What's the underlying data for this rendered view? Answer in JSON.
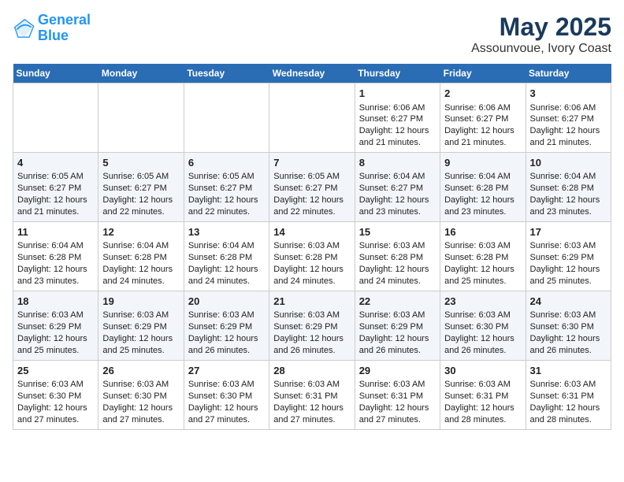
{
  "header": {
    "logo_general": "General",
    "logo_blue": "Blue",
    "month": "May 2025",
    "location": "Assounvoue, Ivory Coast"
  },
  "days_of_week": [
    "Sunday",
    "Monday",
    "Tuesday",
    "Wednesday",
    "Thursday",
    "Friday",
    "Saturday"
  ],
  "weeks": [
    [
      {
        "day": "",
        "info": ""
      },
      {
        "day": "",
        "info": ""
      },
      {
        "day": "",
        "info": ""
      },
      {
        "day": "",
        "info": ""
      },
      {
        "day": "1",
        "info": "Sunrise: 6:06 AM\nSunset: 6:27 PM\nDaylight: 12 hours\nand 21 minutes."
      },
      {
        "day": "2",
        "info": "Sunrise: 6:06 AM\nSunset: 6:27 PM\nDaylight: 12 hours\nand 21 minutes."
      },
      {
        "day": "3",
        "info": "Sunrise: 6:06 AM\nSunset: 6:27 PM\nDaylight: 12 hours\nand 21 minutes."
      }
    ],
    [
      {
        "day": "4",
        "info": "Sunrise: 6:05 AM\nSunset: 6:27 PM\nDaylight: 12 hours\nand 21 minutes."
      },
      {
        "day": "5",
        "info": "Sunrise: 6:05 AM\nSunset: 6:27 PM\nDaylight: 12 hours\nand 22 minutes."
      },
      {
        "day": "6",
        "info": "Sunrise: 6:05 AM\nSunset: 6:27 PM\nDaylight: 12 hours\nand 22 minutes."
      },
      {
        "day": "7",
        "info": "Sunrise: 6:05 AM\nSunset: 6:27 PM\nDaylight: 12 hours\nand 22 minutes."
      },
      {
        "day": "8",
        "info": "Sunrise: 6:04 AM\nSunset: 6:27 PM\nDaylight: 12 hours\nand 23 minutes."
      },
      {
        "day": "9",
        "info": "Sunrise: 6:04 AM\nSunset: 6:28 PM\nDaylight: 12 hours\nand 23 minutes."
      },
      {
        "day": "10",
        "info": "Sunrise: 6:04 AM\nSunset: 6:28 PM\nDaylight: 12 hours\nand 23 minutes."
      }
    ],
    [
      {
        "day": "11",
        "info": "Sunrise: 6:04 AM\nSunset: 6:28 PM\nDaylight: 12 hours\nand 23 minutes."
      },
      {
        "day": "12",
        "info": "Sunrise: 6:04 AM\nSunset: 6:28 PM\nDaylight: 12 hours\nand 24 minutes."
      },
      {
        "day": "13",
        "info": "Sunrise: 6:04 AM\nSunset: 6:28 PM\nDaylight: 12 hours\nand 24 minutes."
      },
      {
        "day": "14",
        "info": "Sunrise: 6:03 AM\nSunset: 6:28 PM\nDaylight: 12 hours\nand 24 minutes."
      },
      {
        "day": "15",
        "info": "Sunrise: 6:03 AM\nSunset: 6:28 PM\nDaylight: 12 hours\nand 24 minutes."
      },
      {
        "day": "16",
        "info": "Sunrise: 6:03 AM\nSunset: 6:28 PM\nDaylight: 12 hours\nand 25 minutes."
      },
      {
        "day": "17",
        "info": "Sunrise: 6:03 AM\nSunset: 6:29 PM\nDaylight: 12 hours\nand 25 minutes."
      }
    ],
    [
      {
        "day": "18",
        "info": "Sunrise: 6:03 AM\nSunset: 6:29 PM\nDaylight: 12 hours\nand 25 minutes."
      },
      {
        "day": "19",
        "info": "Sunrise: 6:03 AM\nSunset: 6:29 PM\nDaylight: 12 hours\nand 25 minutes."
      },
      {
        "day": "20",
        "info": "Sunrise: 6:03 AM\nSunset: 6:29 PM\nDaylight: 12 hours\nand 26 minutes."
      },
      {
        "day": "21",
        "info": "Sunrise: 6:03 AM\nSunset: 6:29 PM\nDaylight: 12 hours\nand 26 minutes."
      },
      {
        "day": "22",
        "info": "Sunrise: 6:03 AM\nSunset: 6:29 PM\nDaylight: 12 hours\nand 26 minutes."
      },
      {
        "day": "23",
        "info": "Sunrise: 6:03 AM\nSunset: 6:30 PM\nDaylight: 12 hours\nand 26 minutes."
      },
      {
        "day": "24",
        "info": "Sunrise: 6:03 AM\nSunset: 6:30 PM\nDaylight: 12 hours\nand 26 minutes."
      }
    ],
    [
      {
        "day": "25",
        "info": "Sunrise: 6:03 AM\nSunset: 6:30 PM\nDaylight: 12 hours\nand 27 minutes."
      },
      {
        "day": "26",
        "info": "Sunrise: 6:03 AM\nSunset: 6:30 PM\nDaylight: 12 hours\nand 27 minutes."
      },
      {
        "day": "27",
        "info": "Sunrise: 6:03 AM\nSunset: 6:30 PM\nDaylight: 12 hours\nand 27 minutes."
      },
      {
        "day": "28",
        "info": "Sunrise: 6:03 AM\nSunset: 6:31 PM\nDaylight: 12 hours\nand 27 minutes."
      },
      {
        "day": "29",
        "info": "Sunrise: 6:03 AM\nSunset: 6:31 PM\nDaylight: 12 hours\nand 27 minutes."
      },
      {
        "day": "30",
        "info": "Sunrise: 6:03 AM\nSunset: 6:31 PM\nDaylight: 12 hours\nand 28 minutes."
      },
      {
        "day": "31",
        "info": "Sunrise: 6:03 AM\nSunset: 6:31 PM\nDaylight: 12 hours\nand 28 minutes."
      }
    ]
  ]
}
